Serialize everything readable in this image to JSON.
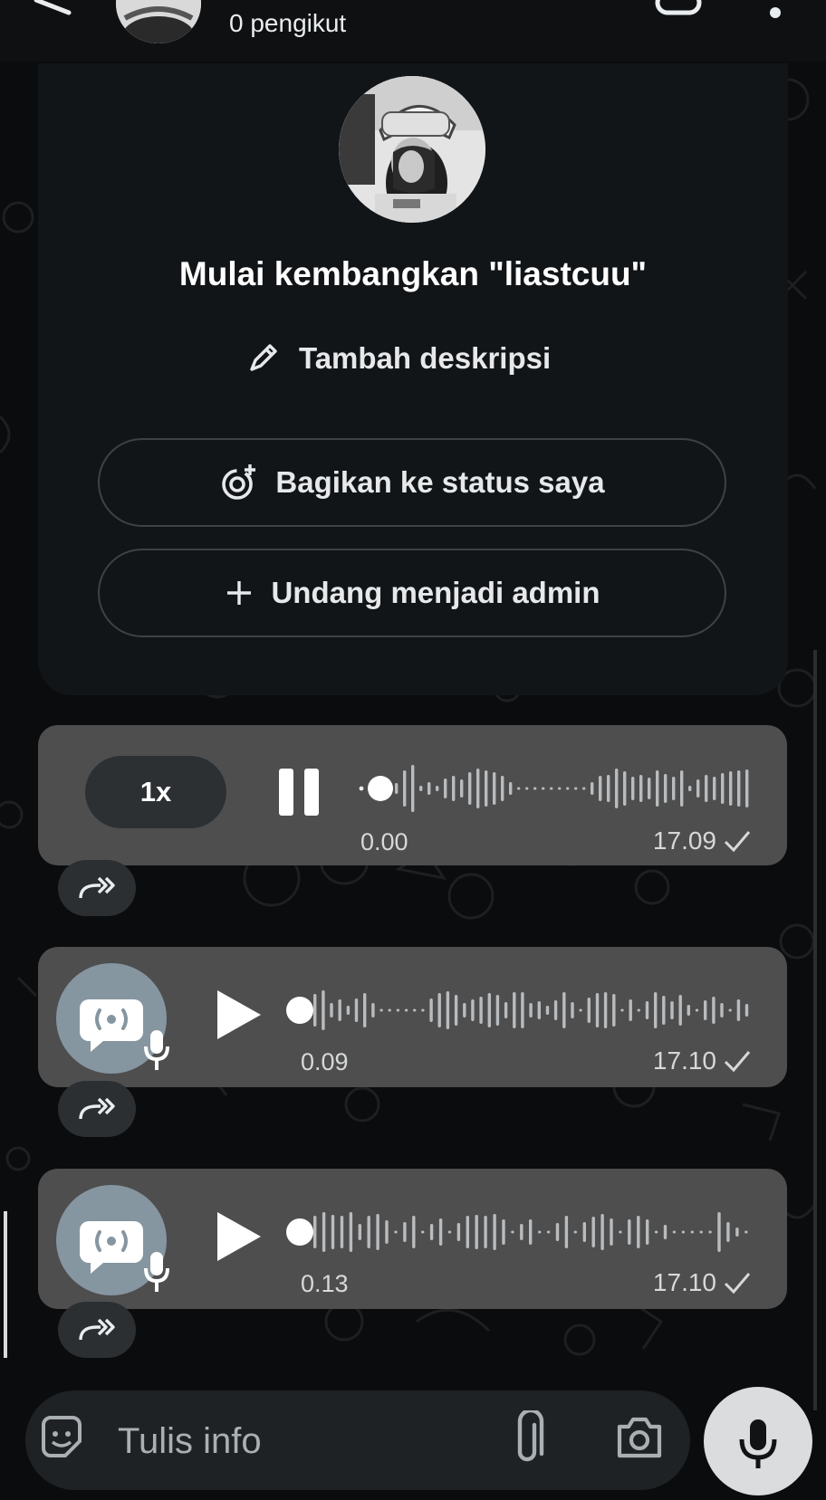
{
  "header": {
    "followers_text": "0 pengikut"
  },
  "channel_card": {
    "title": "Mulai kembangkan \"liastcuu\"",
    "add_description_label": "Tambah deskripsi",
    "share_status_label": "Bagikan ke status saya",
    "invite_admin_label": "Undang menjadi admin"
  },
  "messages": [
    {
      "speed_label": "1x",
      "state": "playing",
      "elapsed": "0.00",
      "sent_time": "17.09",
      "waveform": [
        12,
        40,
        52,
        6,
        14,
        6,
        22,
        28,
        20,
        36,
        44,
        40,
        36,
        28,
        14,
        3,
        3,
        3,
        3,
        3,
        3,
        3,
        3,
        3,
        14,
        28,
        30,
        44,
        38,
        26,
        30,
        24,
        40,
        32,
        26,
        40,
        6,
        20,
        30,
        26,
        34,
        38,
        40,
        42
      ]
    },
    {
      "state": "paused",
      "elapsed": "0.09",
      "sent_time": "17.10",
      "waveform": [
        36,
        44,
        16,
        24,
        10,
        26,
        38,
        16,
        3,
        3,
        3,
        3,
        3,
        3,
        26,
        38,
        42,
        34,
        16,
        24,
        30,
        38,
        34,
        18,
        40,
        40,
        16,
        20,
        10,
        22,
        40,
        18,
        3,
        28,
        38,
        40,
        36,
        3,
        24,
        3,
        20,
        40,
        32,
        20,
        34,
        12,
        3,
        22,
        30,
        16,
        3,
        24,
        14
      ]
    },
    {
      "state": "paused",
      "elapsed": "0.13",
      "sent_time": "17.10",
      "waveform": [
        36,
        44,
        38,
        36,
        44,
        18,
        36,
        40,
        26,
        3,
        22,
        36,
        3,
        18,
        30,
        3,
        20,
        36,
        38,
        36,
        40,
        28,
        3,
        18,
        28,
        3,
        3,
        20,
        36,
        3,
        22,
        34,
        40,
        30,
        3,
        28,
        36,
        28,
        3,
        16,
        3,
        3,
        3,
        3,
        3,
        44,
        22,
        10,
        3
      ]
    }
  ],
  "composer": {
    "placeholder": "Tulis info"
  }
}
